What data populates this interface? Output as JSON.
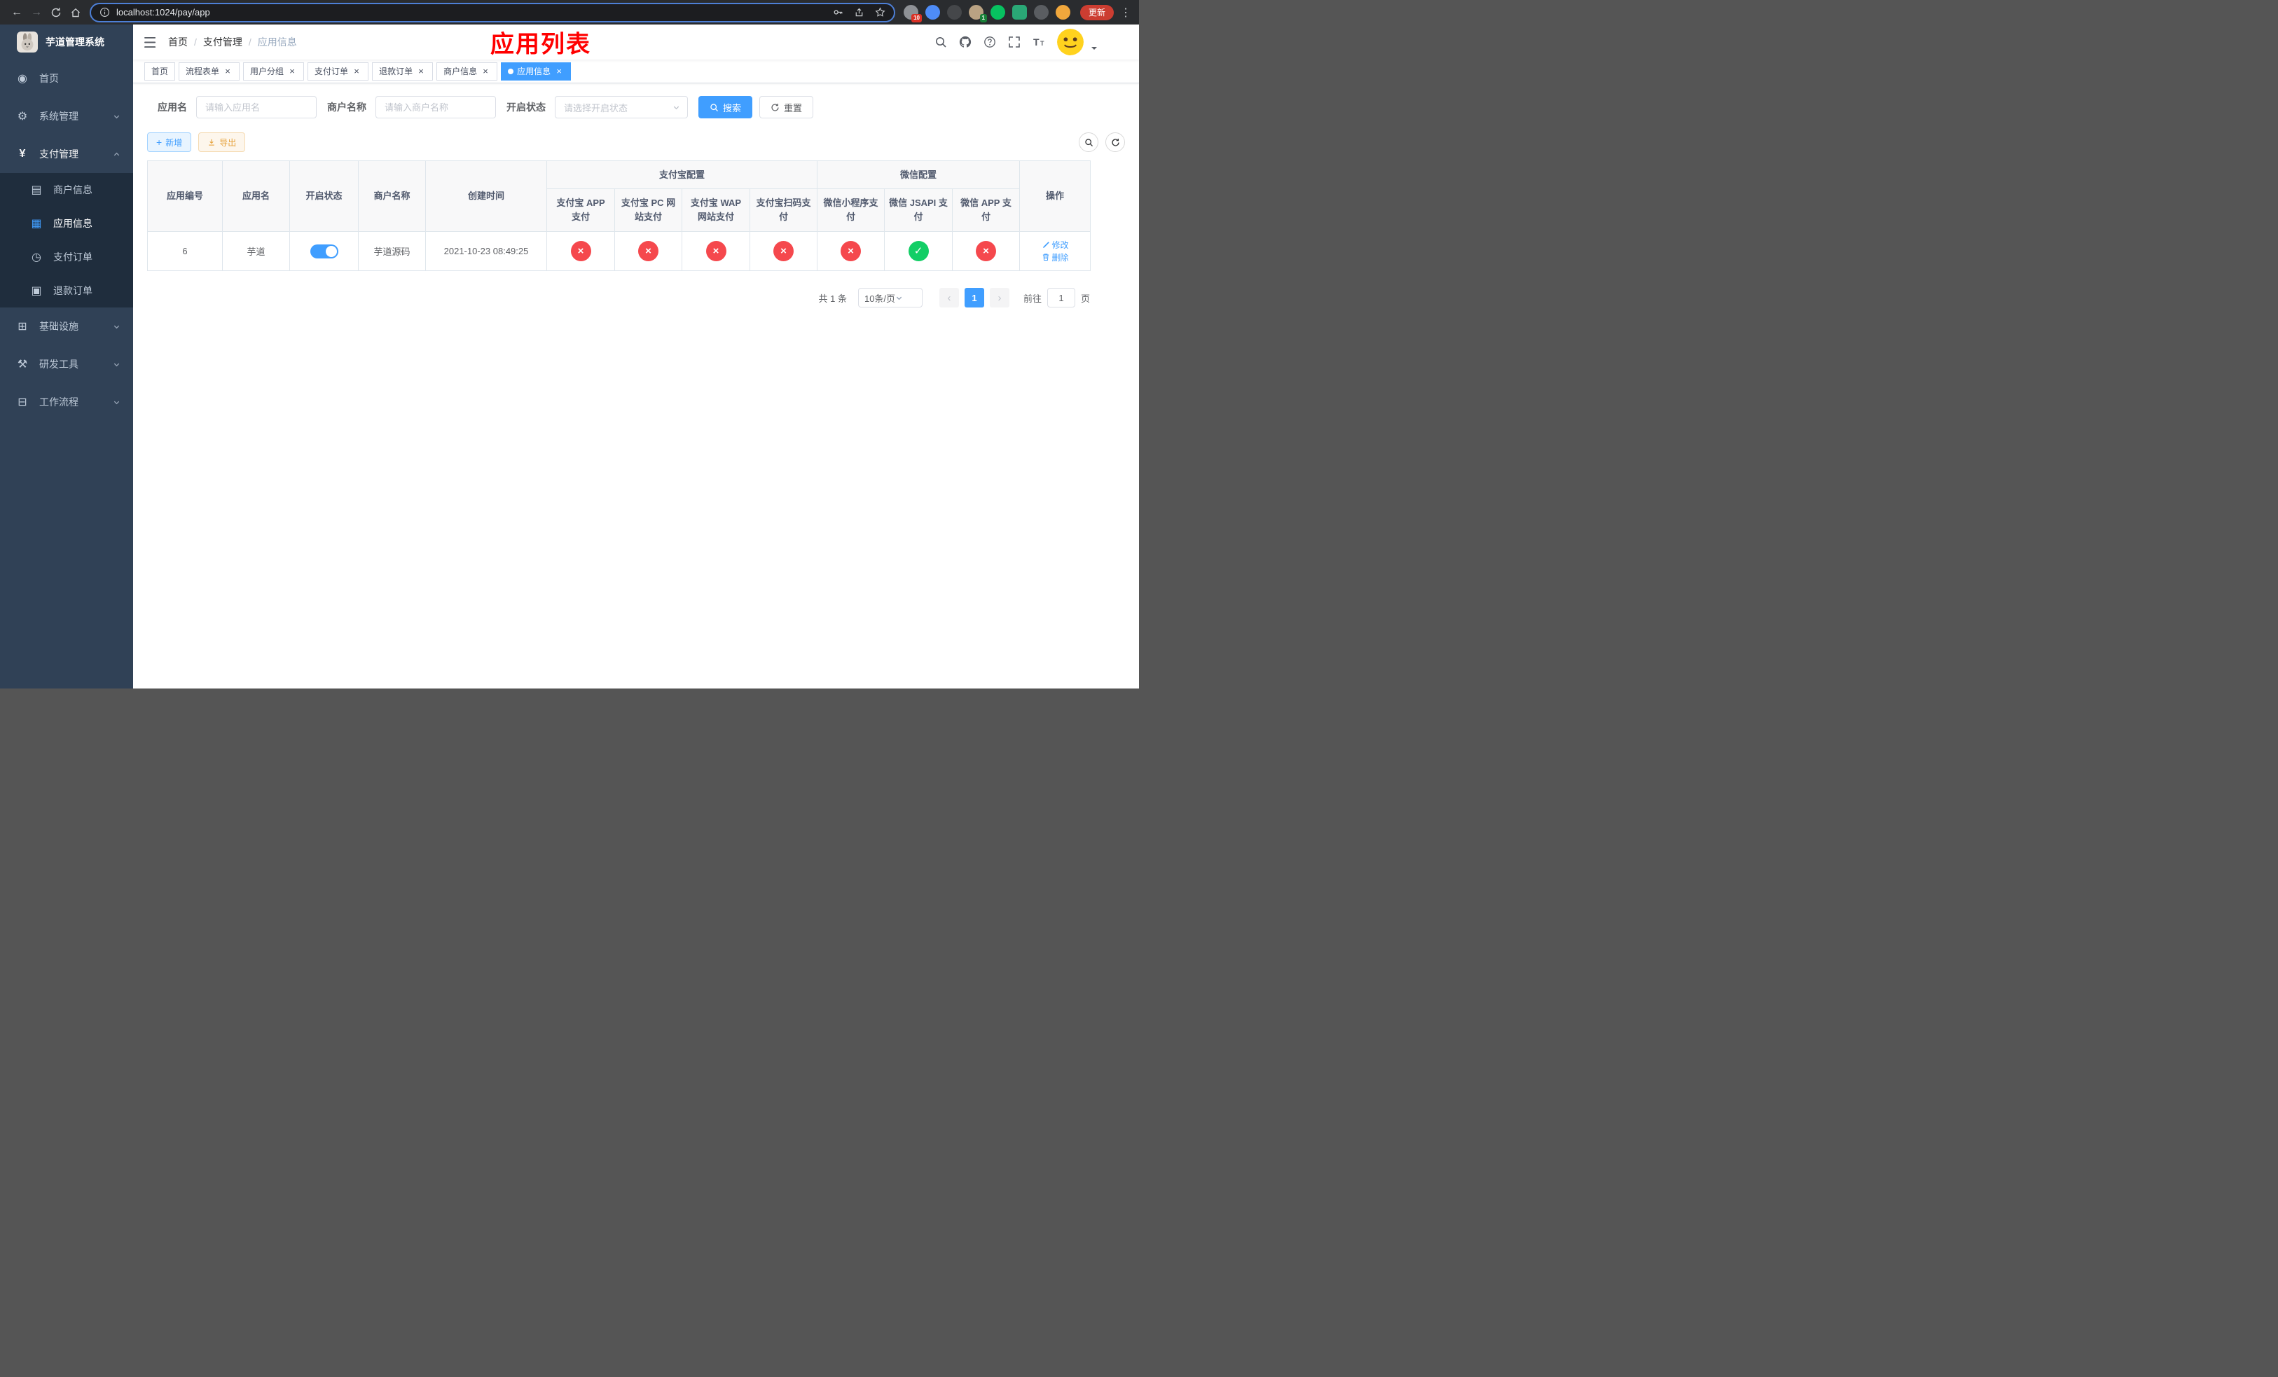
{
  "colors": {
    "accent": "#409eff",
    "danger": "#f5484d",
    "success": "#13ce66",
    "warning": "#e6a23c",
    "sidebar_bg": "#304156",
    "overlay_title_red": "#ff0000",
    "active_tab_bg": "#409eff"
  },
  "icons": {
    "close": "×",
    "plus": "+",
    "prev": "‹",
    "next": "›",
    "kebab": "⋮",
    "back": "←",
    "forward": "→",
    "dashboard": "◉",
    "gear": "⚙",
    "yen": "¥",
    "merchant": "▤",
    "app": "▦",
    "order": "◷",
    "refund": "▣",
    "infra": "⊞",
    "tools": "⚒",
    "workflow": "⊟"
  },
  "browser": {
    "url": "localhost:1024/pay/app",
    "update_button": "更新",
    "ext_badge_1": "10",
    "ext_badge_2": "1"
  },
  "sidebar": {
    "brand": "芋道管理系统",
    "items": [
      {
        "label": "首页"
      },
      {
        "label": "系统管理"
      },
      {
        "label": "支付管理"
      },
      {
        "label": "基础设施"
      },
      {
        "label": "研发工具"
      },
      {
        "label": "工作流程"
      }
    ],
    "submenu": [
      {
        "label": "商户信息"
      },
      {
        "label": "应用信息"
      },
      {
        "label": "支付订单"
      },
      {
        "label": "退款订单"
      }
    ]
  },
  "breadcrumb": {
    "separator": "/",
    "items": [
      "首页",
      "支付管理",
      "应用信息"
    ]
  },
  "overlay_title": "应用列表",
  "tabs": [
    {
      "label": "首页"
    },
    {
      "label": "流程表单"
    },
    {
      "label": "用户分组"
    },
    {
      "label": "支付订单"
    },
    {
      "label": "退款订单"
    },
    {
      "label": "商户信息"
    },
    {
      "label": "应用信息"
    }
  ],
  "filters": {
    "app_name": {
      "label": "应用名",
      "placeholder": "请输入应用名",
      "value": ""
    },
    "merchant_name": {
      "label": "商户名称",
      "placeholder": "请输入商户名称",
      "value": ""
    },
    "status": {
      "label": "开启状态",
      "placeholder": "请选择开启状态",
      "value": ""
    },
    "search_button": "搜索",
    "reset_button": "重置"
  },
  "toolbar": {
    "add_button": "新增",
    "export_button": "导出"
  },
  "table": {
    "headers": {
      "app_id": "应用编号",
      "app_name": "应用名",
      "status": "开启状态",
      "merchant_name": "商户名称",
      "create_time": "创建时间",
      "alipay_group": "支付宝配置",
      "wechat_group": "微信配置",
      "alipay_app": "支付宝 APP 支付",
      "alipay_pc": "支付宝 PC 网站支付",
      "alipay_wap": "支付宝 WAP 网站支付",
      "alipay_qr": "支付宝扫码支付",
      "wechat_lite": "微信小程序支付",
      "wechat_jsapi": "微信 JSAPI 支付",
      "wechat_app": "微信 APP 支付",
      "actions": "操作"
    },
    "rows": [
      {
        "app_id": "6",
        "app_name": "芋道",
        "status_on": true,
        "merchant_name": "芋道源码",
        "create_time": "2021-10-23 08:49:25",
        "alipay_app": false,
        "alipay_pc": false,
        "alipay_wap": false,
        "alipay_qr": false,
        "wechat_lite": false,
        "wechat_jsapi": true,
        "wechat_app": false,
        "edit_action": "修改",
        "delete_action": "删除"
      }
    ]
  },
  "pagination": {
    "total_text": "共 1 条",
    "page_size": "10条/页",
    "current_page": "1",
    "goto_label": "前往",
    "goto_value": "1",
    "goto_unit": "页"
  }
}
